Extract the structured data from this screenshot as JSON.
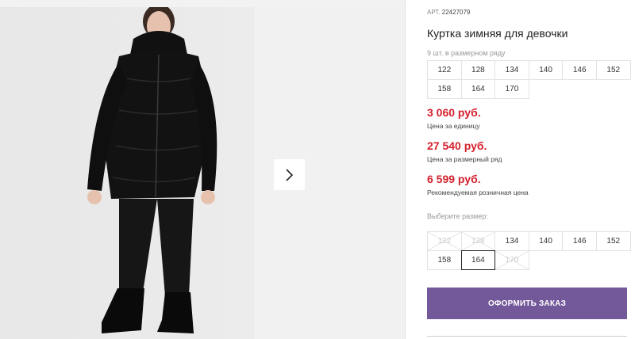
{
  "product": {
    "sku_label": "АРТ.",
    "sku": "22427079",
    "title": "Куртка зимняя для девочки",
    "row_note": "9 шт. в размерном ряду",
    "row_sizes": [
      "122",
      "128",
      "134",
      "140",
      "146",
      "152",
      "158",
      "164",
      "170"
    ]
  },
  "prices": [
    {
      "value": "3 060 руб.",
      "caption": "Цена за единицу"
    },
    {
      "value": "27 540 руб.",
      "caption": "Цена за размерный ряд"
    },
    {
      "value": "6 599 руб.",
      "caption": "Рекомендуемая розничная цена"
    }
  ],
  "size_select": {
    "label": "Выберите размер:",
    "sizes": [
      {
        "label": "122",
        "available": false
      },
      {
        "label": "128",
        "available": false
      },
      {
        "label": "134",
        "available": true
      },
      {
        "label": "140",
        "available": true
      },
      {
        "label": "146",
        "available": true
      },
      {
        "label": "152",
        "available": true
      },
      {
        "label": "158",
        "available": true
      },
      {
        "label": "164",
        "available": true,
        "selected": true
      },
      {
        "label": "170",
        "available": false
      }
    ]
  },
  "order_button": {
    "label": "ОФОРМИТЬ ЗАКАЗ"
  },
  "gallery": {
    "next_icon": "chevron-right-icon"
  },
  "colors": {
    "price": "#d4202c",
    "accent": "#74599a"
  }
}
